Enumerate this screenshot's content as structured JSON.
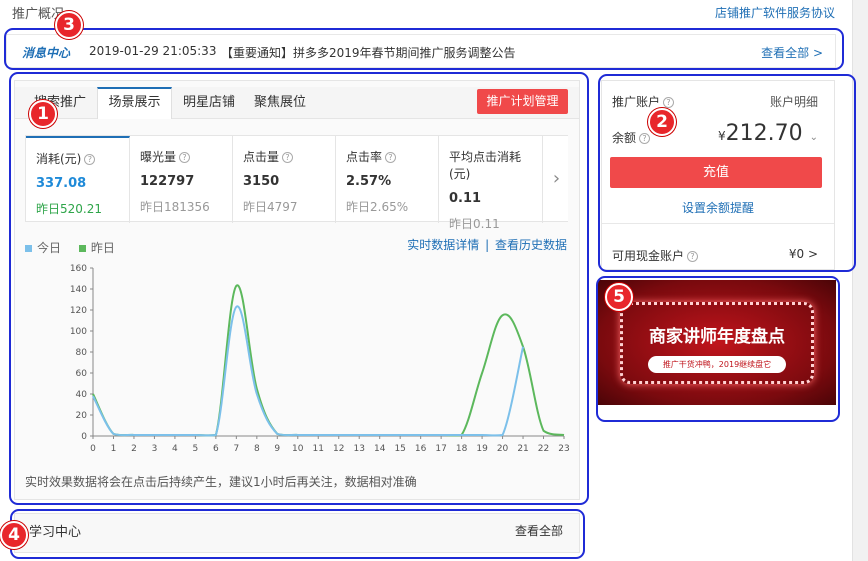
{
  "header": {
    "section_title": "推广概况",
    "service_agreement": "店铺推广软件服务协议"
  },
  "notice": {
    "label": "消息中心",
    "datetime": "2019-01-29 21:05:33",
    "text": "【重要通知】拼多多2019年春节期间推广服务调整公告",
    "view_all": "查看全部 >"
  },
  "tabs": [
    {
      "label": "搜索推广"
    },
    {
      "label": "场景展示"
    },
    {
      "label": "明星店铺"
    },
    {
      "label": "聚焦展位"
    }
  ],
  "plan_button": "推广计划管理",
  "metrics": [
    {
      "title": "消耗(元)",
      "value": "337.08",
      "yesterday": "昨日520.21"
    },
    {
      "title": "曝光量",
      "value": "122797",
      "yesterday": "昨日181356"
    },
    {
      "title": "点击量",
      "value": "3150",
      "yesterday": "昨日4797"
    },
    {
      "title": "点击率",
      "value": "2.57%",
      "yesterday": "昨日2.65%"
    },
    {
      "title": "平均点击消耗(元)",
      "value": "0.11",
      "yesterday": "昨日0.11"
    }
  ],
  "metrics_next": "›",
  "legend": {
    "today": "今日",
    "yesterday": "昨日"
  },
  "links": {
    "realtime": "实时数据详情",
    "sep": "|",
    "history": "查看历史数据"
  },
  "chart_footer": "实时效果数据将会在点击后持续产生，建议1小时后再关注，数据相对准确",
  "colors": {
    "today": "#7cc0ea",
    "yesterday": "#5cb85c",
    "accent_red": "#f0494a",
    "link_blue": "#1f6fb5",
    "annotation_blue": "#1f2bd6"
  },
  "chart_data": {
    "type": "line",
    "x": [
      0,
      1,
      2,
      3,
      4,
      5,
      6,
      7,
      8,
      9,
      10,
      11,
      12,
      13,
      14,
      15,
      16,
      17,
      18,
      19,
      20,
      21,
      22,
      23
    ],
    "ylim": [
      0,
      160
    ],
    "yticks": [
      0,
      20,
      40,
      60,
      80,
      100,
      120,
      140,
      160
    ],
    "series": [
      {
        "name": "今日",
        "values": [
          38,
          2,
          1,
          1,
          1,
          1,
          1,
          123,
          40,
          2,
          1,
          1,
          1,
          1,
          1,
          1,
          1,
          1,
          1,
          1,
          1,
          85,
          null,
          null
        ]
      },
      {
        "name": "昨日",
        "values": [
          40,
          2,
          1,
          1,
          1,
          1,
          1,
          143,
          45,
          2,
          1,
          1,
          1,
          1,
          1,
          1,
          1,
          1,
          1,
          60,
          115,
          85,
          5,
          1
        ]
      }
    ],
    "grid": false,
    "legend": "top-left"
  },
  "account": {
    "title": "推广账户",
    "detail": "账户明细",
    "balance_label": "余额",
    "currency": "¥",
    "balance": "212.70",
    "recharge": "充值",
    "reminder": "设置余额提醒",
    "cash_label": "可用现金账户",
    "cash_value": "¥0 >"
  },
  "banner": {
    "title": "商家讲师年度盘点",
    "subtitle": "推广干货冲鸭，2019继续盘它"
  },
  "learning": {
    "title": "学习中心",
    "view_all": "查看全部"
  },
  "markers": [
    "1",
    "2",
    "3",
    "4",
    "5"
  ]
}
